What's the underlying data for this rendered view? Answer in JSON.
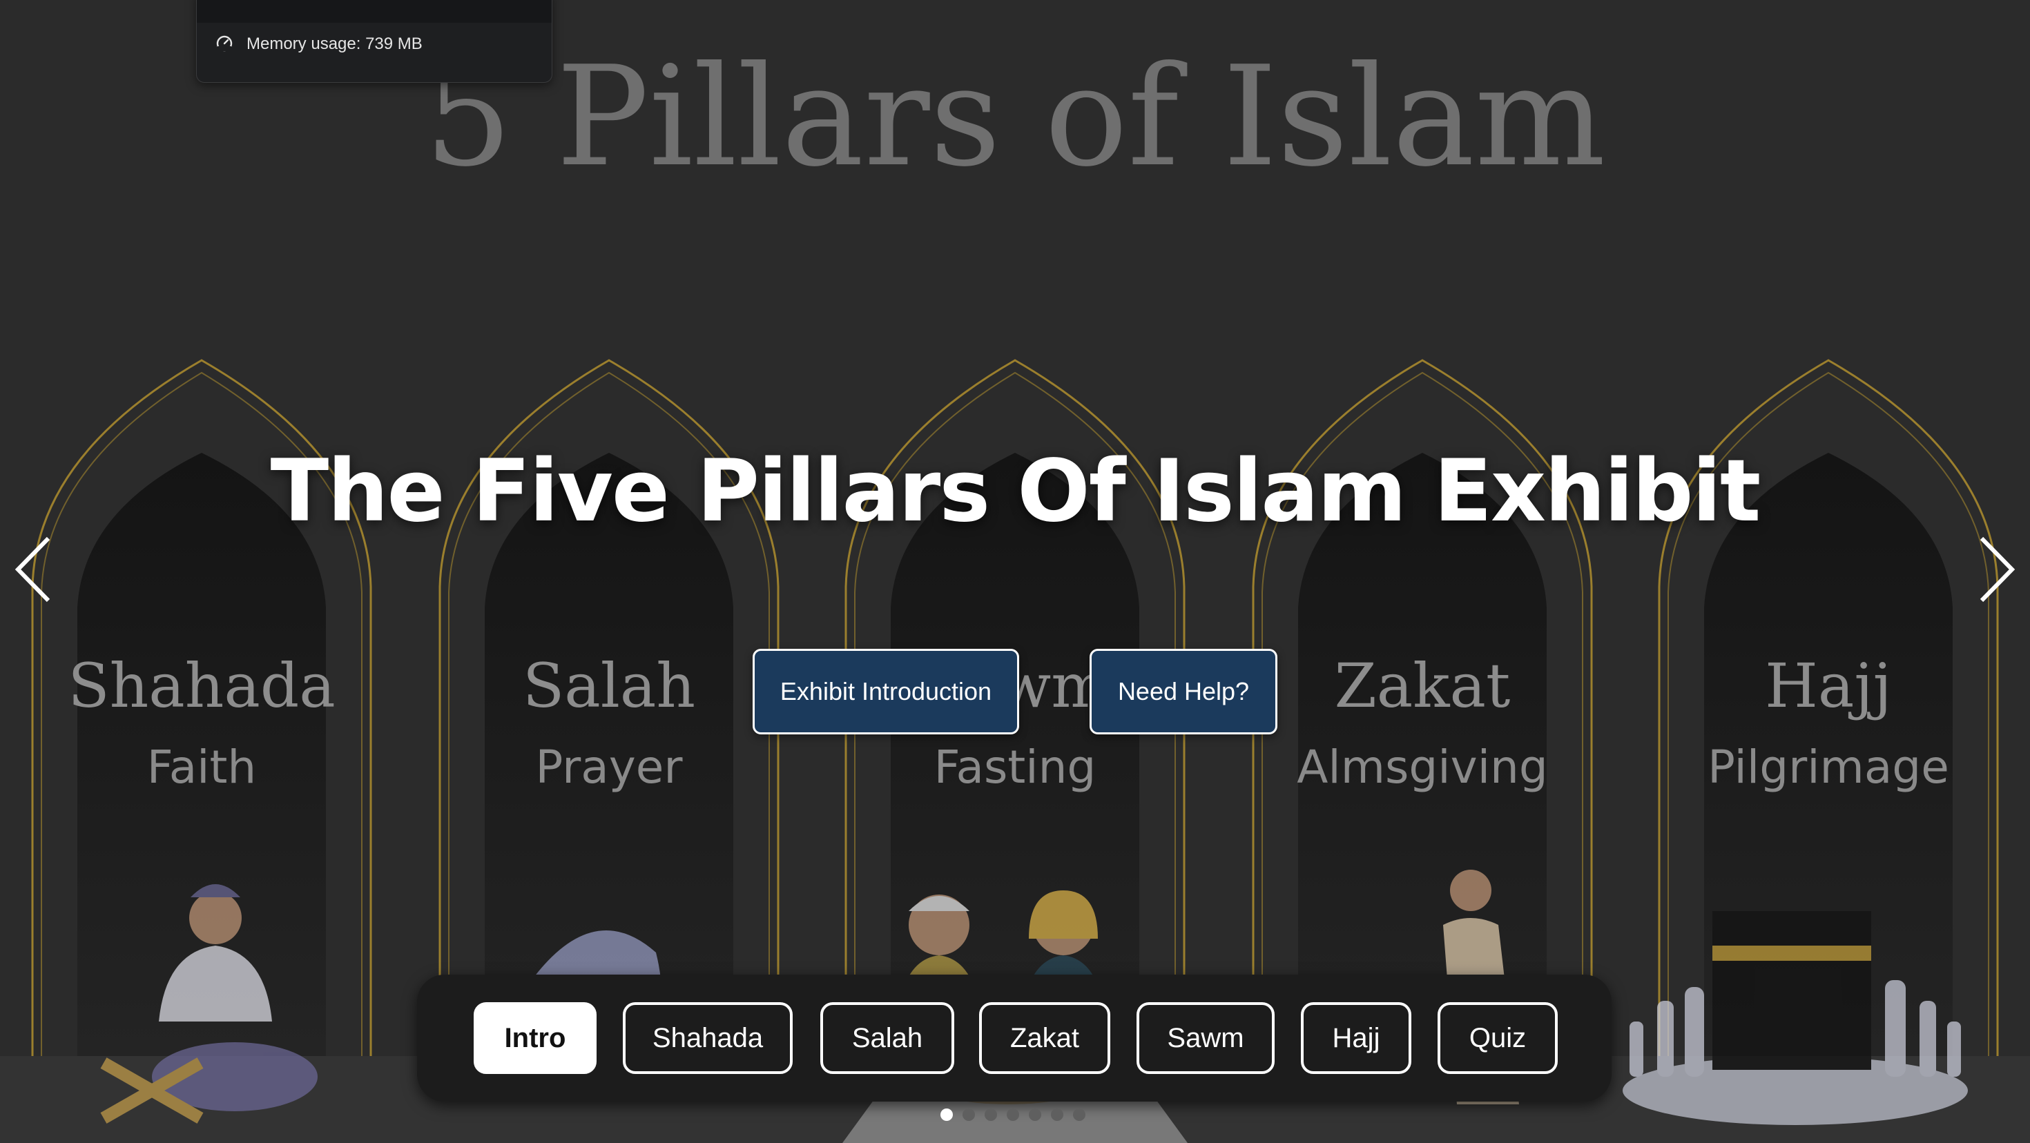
{
  "memory": {
    "label": "Memory usage: 739 MB",
    "icon": "gauge-icon"
  },
  "banner": {
    "title": "5 Pillars of Islam"
  },
  "pillars": [
    {
      "name": "Shahada",
      "meaning": "Faith"
    },
    {
      "name": "Salah",
      "meaning": "Prayer"
    },
    {
      "name": "Sawm",
      "meaning": "Fasting"
    },
    {
      "name": "Zakat",
      "meaning": "Almsgiving"
    },
    {
      "name": "Hajj",
      "meaning": "Pilgrimage"
    }
  ],
  "main_title": "The Five Pillars Of Islam Exhibit",
  "buttons": {
    "intro": "Exhibit Introduction",
    "help": "Need Help?"
  },
  "nav": {
    "items": [
      "Intro",
      "Shahada",
      "Salah",
      "Zakat",
      "Sawm",
      "Hajj",
      "Quiz"
    ],
    "active": "Intro"
  },
  "slides": {
    "count": 7,
    "current": 1
  },
  "colors": {
    "background": "#2a2a2a",
    "arch_gold": "#b8952e",
    "button_blue": "#1b3a5c",
    "nav_bg": "#1c1c1c"
  }
}
